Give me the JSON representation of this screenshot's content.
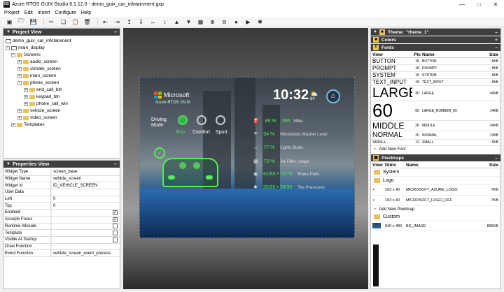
{
  "window": {
    "title": "Azure RTOS GUIX Studio 6.1.12.0 - demo_guix_car_infotainment.gxp",
    "icon_label": "IGI"
  },
  "menu": [
    "Project",
    "Edit",
    "Insert",
    "Configure",
    "Help"
  ],
  "project_view": {
    "title": "Project View",
    "nodes": [
      {
        "label": "demo_guix_car_infotainment"
      },
      {
        "label": "main_display"
      },
      {
        "label": "Screens"
      },
      {
        "label": "audio_screen"
      },
      {
        "label": "climate_screen"
      },
      {
        "label": "main_screen"
      },
      {
        "label": "phone_screen"
      },
      {
        "label": "end_call_btn"
      },
      {
        "label": "keypad_btn"
      },
      {
        "label": "phone_call_win"
      },
      {
        "label": "vehicle_screen"
      },
      {
        "label": "video_screen"
      },
      {
        "label": "Templates"
      }
    ]
  },
  "properties_view": {
    "title": "Properties View",
    "rows": [
      {
        "key": "Widget Type",
        "value": "screen_base"
      },
      {
        "key": "Widget Name",
        "value": "vehicle_screen"
      },
      {
        "key": "Widget Id",
        "value": "ID_VEHICLE_SCREEN"
      },
      {
        "key": "User Data",
        "value": ""
      },
      {
        "key": "Left",
        "value": "0"
      },
      {
        "key": "Top",
        "value": "0"
      },
      {
        "key": "Enabled",
        "value": "",
        "checked": true
      },
      {
        "key": "Accepts Focus",
        "value": "",
        "checked": true
      },
      {
        "key": "Runtime Allocate",
        "value": "",
        "checked": false
      },
      {
        "key": "Template",
        "value": "",
        "checked": false
      },
      {
        "key": "Visible At Startup",
        "value": "",
        "checked": false
      },
      {
        "key": "Draw Function",
        "value": ""
      },
      {
        "key": "Event Function",
        "value": "vehicle_screen_event_process"
      }
    ]
  },
  "screen": {
    "brand": "Microsoft",
    "sub": "Azure RTOS GUIX",
    "time": "10:32",
    "temp": "64",
    "driving_mode": "Driving Mode",
    "modes": [
      "Eco",
      "Comfort",
      "Sport"
    ],
    "stats": [
      {
        "value": "86 %",
        "extra": "386",
        "label": "Miles"
      },
      {
        "value": "54 %",
        "extra": "",
        "label": "Windshield Washer Level"
      },
      {
        "value": "77 %",
        "extra": "",
        "label": "Lights Bulbs"
      },
      {
        "value": "73 %",
        "extra": "",
        "label": "Air Filter Usage"
      },
      {
        "value": "61/65 • 71/75",
        "extra": "",
        "label": "Brake Pads"
      },
      {
        "value": "35/35 • 38/39",
        "extra": "",
        "label": "Tire Pressures"
      }
    ]
  },
  "theme": {
    "title": "Theme:",
    "value": "\"theme_1\""
  },
  "colors": {
    "title": "Colors"
  },
  "fonts": {
    "title": "Fonts",
    "headers": [
      "View",
      "Pix",
      "Name",
      "Size"
    ],
    "rows": [
      {
        "view": "BUTTON",
        "pix": "18",
        "name": "BUTTON",
        "size": "8KB"
      },
      {
        "view": "PROMPT",
        "pix": "18",
        "name": "PROMPT",
        "size": "8KB"
      },
      {
        "view": "SYSTEM",
        "pix": "18",
        "name": "SYSTEM",
        "size": "8KB"
      },
      {
        "view": "TEXT_INPUT",
        "pix": "18",
        "name": "TEXT_INPUT",
        "size": "8KB"
      },
      {
        "view": "LARGE",
        "pix": "40",
        "name": "LARGE",
        "size": "49KB"
      },
      {
        "view": "60",
        "pix": "60",
        "name": "LARGE_NUMBER_60",
        "size": "14KB"
      },
      {
        "view": "MIDDLE",
        "pix": "28",
        "name": "MIDDLE",
        "size": "24KB"
      },
      {
        "view": "NORMAL",
        "pix": "20",
        "name": "NORMAL",
        "size": "13KB"
      },
      {
        "view": "SMALL",
        "pix": "12",
        "name": "SMALL",
        "size": "5KB"
      }
    ],
    "add_label": "Add New Font"
  },
  "pixelmaps": {
    "title": "Pixelmaps",
    "headers": [
      "View",
      "Dims",
      "Name",
      "Size"
    ],
    "groups": [
      {
        "name": "System",
        "items": []
      },
      {
        "name": "Logo",
        "items": [
          {
            "dims": "103 x 40",
            "name": "MICROSOFT_AZURE_LOGO",
            "size": "7KB"
          },
          {
            "dims": "103 x 40",
            "name": "MICROSOFT_LOGO_OFF",
            "size": "7KB"
          }
        ]
      }
    ],
    "add_label": "Add New Pixelmap",
    "custom_group": "Custom",
    "custom_items": [
      {
        "dims": "640 x 480",
        "name": "BG_IMAGE",
        "size": "896KB"
      }
    ]
  }
}
